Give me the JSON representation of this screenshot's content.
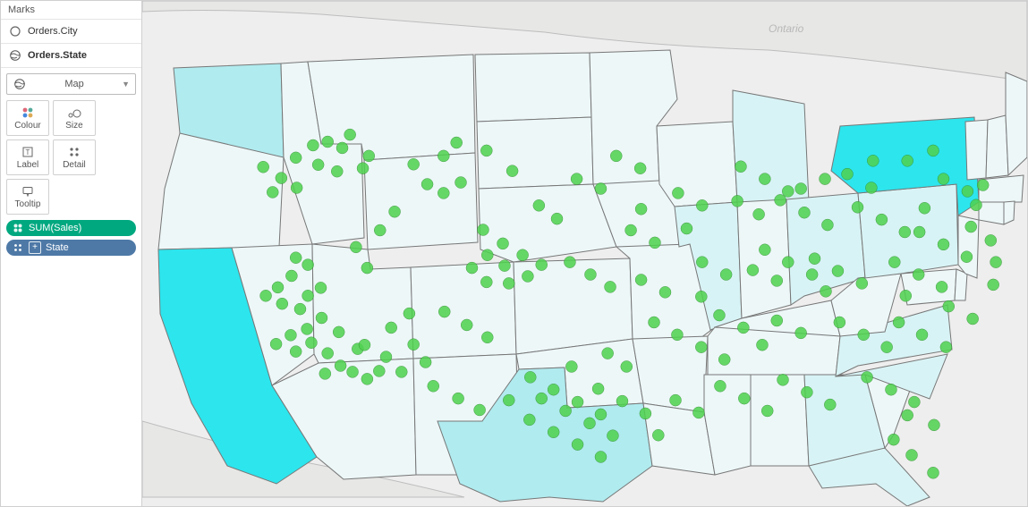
{
  "panel_title": "Marks",
  "layers": [
    {
      "label": "Orders.City",
      "icon": "circle-icon"
    },
    {
      "label": "Orders.State",
      "icon": "globe-icon"
    }
  ],
  "marktype": {
    "label": "Map",
    "icon": "globe-icon"
  },
  "cards": [
    {
      "label": "Colour",
      "icon": "colour"
    },
    {
      "label": "Size",
      "icon": "size"
    },
    {
      "label": "Label",
      "icon": "label"
    },
    {
      "label": "Detail",
      "icon": "detail"
    },
    {
      "label": "Tooltip",
      "icon": "tooltip"
    }
  ],
  "pills": [
    {
      "label": "SUM(Sales)",
      "style": "green",
      "icon": "colour"
    },
    {
      "label": "State",
      "style": "blue",
      "icon": "detail",
      "plus": true
    }
  ],
  "map_labels": {
    "ontario": "Ontario"
  },
  "chart_data": {
    "type": "map",
    "title": "",
    "layers": [
      {
        "name": "Orders.State",
        "geometry": "US states",
        "measure": "SUM(Sales)",
        "encoding": "fill color (light cyan → bright cyan)",
        "states": [
          {
            "name": "California",
            "level": 3
          },
          {
            "name": "New York",
            "level": 3
          },
          {
            "name": "Texas",
            "level": 2
          },
          {
            "name": "Washington",
            "level": 2
          },
          {
            "name": "Florida",
            "level": 1
          },
          {
            "name": "Pennsylvania",
            "level": 1
          },
          {
            "name": "Illinois",
            "level": 1
          },
          {
            "name": "Ohio",
            "level": 1
          },
          {
            "name": "Michigan",
            "level": 1
          },
          {
            "name": "Georgia",
            "level": 1
          },
          {
            "name": "North Carolina",
            "level": 1
          },
          {
            "name": "Virginia",
            "level": 1
          }
        ]
      },
      {
        "name": "Orders.City",
        "geometry": "city points",
        "mark": "circle",
        "color": "#4fd24f",
        "cities_norm": [
          [
            0.195,
            0.197
          ],
          [
            0.212,
            0.211
          ],
          [
            0.221,
            0.181
          ],
          [
            0.243,
            0.229
          ],
          [
            0.236,
            0.257
          ],
          [
            0.206,
            0.264
          ],
          [
            0.184,
            0.249
          ],
          [
            0.158,
            0.233
          ],
          [
            0.178,
            0.205
          ],
          [
            0.12,
            0.254
          ],
          [
            0.141,
            0.279
          ],
          [
            0.159,
            0.301
          ],
          [
            0.131,
            0.311
          ],
          [
            0.158,
            0.459
          ],
          [
            0.172,
            0.475
          ],
          [
            0.153,
            0.5
          ],
          [
            0.137,
            0.526
          ],
          [
            0.123,
            0.545
          ],
          [
            0.142,
            0.563
          ],
          [
            0.163,
            0.575
          ],
          [
            0.188,
            0.595
          ],
          [
            0.171,
            0.62
          ],
          [
            0.152,
            0.634
          ],
          [
            0.135,
            0.654
          ],
          [
            0.158,
            0.671
          ],
          [
            0.176,
            0.651
          ],
          [
            0.195,
            0.675
          ],
          [
            0.21,
            0.703
          ],
          [
            0.192,
            0.721
          ],
          [
            0.224,
            0.717
          ],
          [
            0.241,
            0.733
          ],
          [
            0.255,
            0.715
          ],
          [
            0.208,
            0.627
          ],
          [
            0.23,
            0.665
          ],
          [
            0.172,
            0.545
          ],
          [
            0.187,
            0.527
          ],
          [
            0.238,
            0.656
          ],
          [
            0.263,
            0.683
          ],
          [
            0.281,
            0.717
          ],
          [
            0.309,
            0.695
          ],
          [
            0.295,
            0.655
          ],
          [
            0.269,
            0.617
          ],
          [
            0.29,
            0.585
          ],
          [
            0.318,
            0.749
          ],
          [
            0.347,
            0.777
          ],
          [
            0.372,
            0.803
          ],
          [
            0.241,
            0.482
          ],
          [
            0.228,
            0.435
          ],
          [
            0.256,
            0.397
          ],
          [
            0.273,
            0.355
          ],
          [
            0.295,
            0.248
          ],
          [
            0.311,
            0.293
          ],
          [
            0.33,
            0.313
          ],
          [
            0.35,
            0.289
          ],
          [
            0.33,
            0.229
          ],
          [
            0.376,
            0.396
          ],
          [
            0.399,
            0.427
          ],
          [
            0.422,
            0.453
          ],
          [
            0.401,
            0.477
          ],
          [
            0.381,
            0.453
          ],
          [
            0.363,
            0.482
          ],
          [
            0.38,
            0.514
          ],
          [
            0.406,
            0.517
          ],
          [
            0.428,
            0.501
          ],
          [
            0.444,
            0.475
          ],
          [
            0.331,
            0.581
          ],
          [
            0.357,
            0.611
          ],
          [
            0.381,
            0.639
          ],
          [
            0.345,
            0.199
          ],
          [
            0.38,
            0.217
          ],
          [
            0.41,
            0.263
          ],
          [
            0.441,
            0.341
          ],
          [
            0.462,
            0.371
          ],
          [
            0.477,
            0.469
          ],
          [
            0.501,
            0.497
          ],
          [
            0.524,
            0.525
          ],
          [
            0.485,
            0.281
          ],
          [
            0.513,
            0.303
          ],
          [
            0.531,
            0.229
          ],
          [
            0.559,
            0.257
          ],
          [
            0.548,
            0.397
          ],
          [
            0.576,
            0.425
          ],
          [
            0.56,
            0.349
          ],
          [
            0.56,
            0.509
          ],
          [
            0.588,
            0.537
          ],
          [
            0.431,
            0.729
          ],
          [
            0.458,
            0.757
          ],
          [
            0.486,
            0.785
          ],
          [
            0.513,
            0.813
          ],
          [
            0.444,
            0.777
          ],
          [
            0.472,
            0.805
          ],
          [
            0.5,
            0.833
          ],
          [
            0.527,
            0.861
          ],
          [
            0.458,
            0.853
          ],
          [
            0.486,
            0.881
          ],
          [
            0.513,
            0.909
          ],
          [
            0.43,
            0.825
          ],
          [
            0.51,
            0.755
          ],
          [
            0.538,
            0.783
          ],
          [
            0.565,
            0.811
          ],
          [
            0.479,
            0.705
          ],
          [
            0.406,
            0.781
          ],
          [
            0.543,
            0.705
          ],
          [
            0.521,
            0.675
          ],
          [
            0.575,
            0.605
          ],
          [
            0.602,
            0.633
          ],
          [
            0.63,
            0.661
          ],
          [
            0.657,
            0.689
          ],
          [
            0.6,
            0.781
          ],
          [
            0.627,
            0.809
          ],
          [
            0.58,
            0.86
          ],
          [
            0.603,
            0.313
          ],
          [
            0.631,
            0.341
          ],
          [
            0.613,
            0.393
          ],
          [
            0.631,
            0.469
          ],
          [
            0.659,
            0.497
          ],
          [
            0.651,
            0.589
          ],
          [
            0.679,
            0.617
          ],
          [
            0.63,
            0.547
          ],
          [
            0.676,
            0.253
          ],
          [
            0.704,
            0.281
          ],
          [
            0.731,
            0.309
          ],
          [
            0.697,
            0.361
          ],
          [
            0.672,
            0.331
          ],
          [
            0.704,
            0.441
          ],
          [
            0.731,
            0.469
          ],
          [
            0.759,
            0.497
          ],
          [
            0.718,
            0.511
          ],
          [
            0.69,
            0.487
          ],
          [
            0.718,
            0.601
          ],
          [
            0.746,
            0.629
          ],
          [
            0.701,
            0.656
          ],
          [
            0.652,
            0.749
          ],
          [
            0.68,
            0.777
          ],
          [
            0.707,
            0.805
          ],
          [
            0.725,
            0.735
          ],
          [
            0.753,
            0.763
          ],
          [
            0.78,
            0.791
          ],
          [
            0.722,
            0.329
          ],
          [
            0.75,
            0.357
          ],
          [
            0.777,
            0.385
          ],
          [
            0.746,
            0.303
          ],
          [
            0.774,
            0.281
          ],
          [
            0.762,
            0.461
          ],
          [
            0.789,
            0.489
          ],
          [
            0.817,
            0.517
          ],
          [
            0.775,
            0.535
          ],
          [
            0.791,
            0.605
          ],
          [
            0.819,
            0.633
          ],
          [
            0.846,
            0.661
          ],
          [
            0.812,
            0.345
          ],
          [
            0.84,
            0.373
          ],
          [
            0.867,
            0.401
          ],
          [
            0.828,
            0.301
          ],
          [
            0.823,
            0.729
          ],
          [
            0.851,
            0.757
          ],
          [
            0.878,
            0.785
          ],
          [
            0.855,
            0.469
          ],
          [
            0.883,
            0.497
          ],
          [
            0.91,
            0.525
          ],
          [
            0.868,
            0.545
          ],
          [
            0.86,
            0.605
          ],
          [
            0.887,
            0.633
          ],
          [
            0.915,
            0.661
          ],
          [
            0.901,
            0.837
          ],
          [
            0.854,
            0.87
          ],
          [
            0.875,
            0.905
          ],
          [
            0.9,
            0.945
          ],
          [
            0.87,
            0.815
          ],
          [
            0.884,
            0.401
          ],
          [
            0.912,
            0.429
          ],
          [
            0.939,
            0.457
          ],
          [
            0.89,
            0.347
          ],
          [
            0.912,
            0.281
          ],
          [
            0.94,
            0.309
          ],
          [
            0.87,
            0.24
          ],
          [
            0.9,
            0.217
          ],
          [
            0.918,
            0.569
          ],
          [
            0.946,
            0.597
          ],
          [
            0.944,
            0.389
          ],
          [
            0.95,
            0.34
          ],
          [
            0.967,
            0.42
          ],
          [
            0.958,
            0.295
          ],
          [
            0.973,
            0.469
          ],
          [
            0.97,
            0.52
          ],
          [
            0.8,
            0.27
          ],
          [
            0.83,
            0.24
          ]
        ]
      }
    ]
  }
}
